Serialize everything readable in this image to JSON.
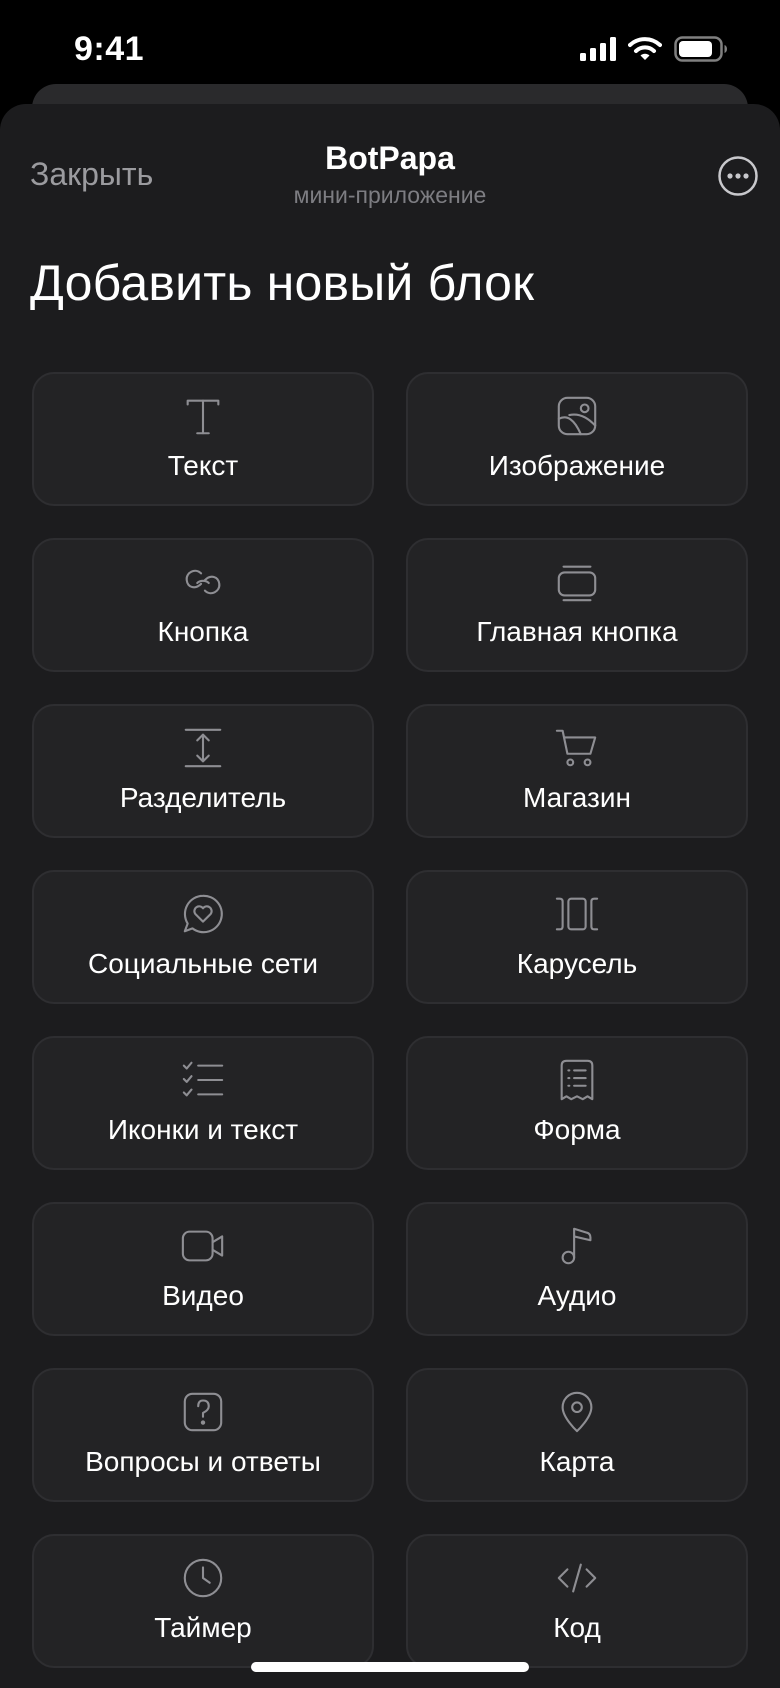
{
  "status_bar": {
    "time": "9:41"
  },
  "header": {
    "close_label": "Закрыть",
    "title": "BotPapa",
    "subtitle": "мини-приложение"
  },
  "page": {
    "title": "Добавить новый блок"
  },
  "blocks": [
    {
      "label": "Текст",
      "icon": "text-icon"
    },
    {
      "label": "Изображение",
      "icon": "image-icon"
    },
    {
      "label": "Кнопка",
      "icon": "link-icon"
    },
    {
      "label": "Главная кнопка",
      "icon": "main-button-icon"
    },
    {
      "label": "Разделитель",
      "icon": "divider-icon"
    },
    {
      "label": "Магазин",
      "icon": "cart-icon"
    },
    {
      "label": "Социальные сети",
      "icon": "chat-heart-icon"
    },
    {
      "label": "Карусель",
      "icon": "carousel-icon"
    },
    {
      "label": "Иконки и текст",
      "icon": "checklist-icon"
    },
    {
      "label": "Форма",
      "icon": "form-icon"
    },
    {
      "label": "Видео",
      "icon": "video-icon"
    },
    {
      "label": "Аудио",
      "icon": "music-note-icon"
    },
    {
      "label": "Вопросы и ответы",
      "icon": "question-icon"
    },
    {
      "label": "Карта",
      "icon": "map-pin-icon"
    },
    {
      "label": "Таймер",
      "icon": "clock-icon"
    },
    {
      "label": "Код",
      "icon": "code-icon"
    }
  ],
  "colors": {
    "background": "#000000",
    "sheet": "#1c1c1e",
    "tile": "#232325",
    "tile_border": "#2e2e31",
    "icon": "#8e8e93",
    "muted_text": "#9b9b9f"
  }
}
